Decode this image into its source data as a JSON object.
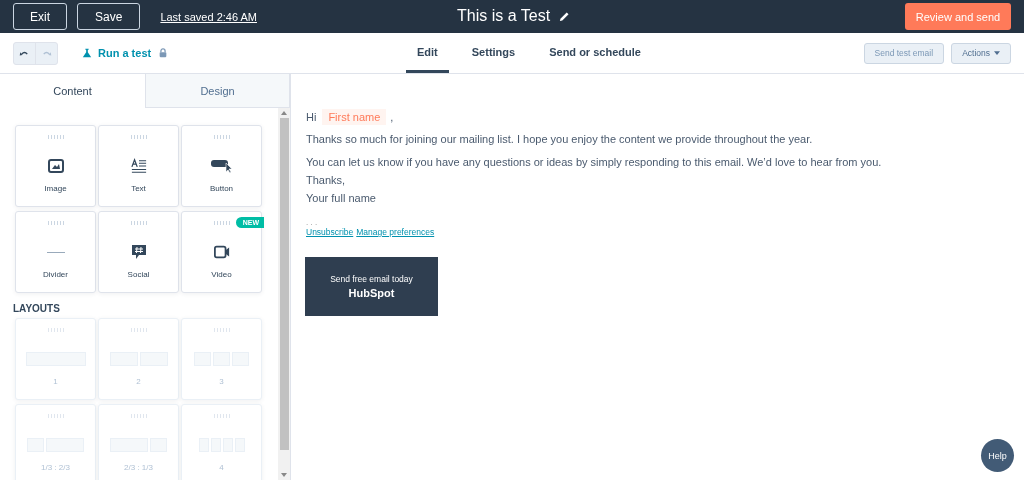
{
  "top_bar": {
    "buttons": [
      "Exit",
      "Save"
    ],
    "last_saved": "Last saved 2:46 AM",
    "title": "This is a Test",
    "primary_button": "Review and send"
  },
  "toolbar": {
    "run_test": "Run a test",
    "tabs": [
      {
        "label": "Edit",
        "selected": true
      },
      {
        "label": "Settings",
        "selected": false
      },
      {
        "label": "Send or schedule",
        "selected": false
      }
    ],
    "send_test": "Send test email",
    "actions": "Actions"
  },
  "sidebar": {
    "tabs": [
      {
        "label": "Content",
        "selected": true
      },
      {
        "label": "Design",
        "selected": false
      }
    ],
    "modules": [
      {
        "label": "Image",
        "kind": "image"
      },
      {
        "label": "Text",
        "kind": "text"
      },
      {
        "label": "Button",
        "kind": "button"
      },
      {
        "label": "Divider",
        "kind": "divider"
      },
      {
        "label": "Social",
        "kind": "social"
      },
      {
        "label": "Video",
        "kind": "video",
        "badge": "NEW"
      }
    ],
    "layouts_heading": "LAYOUTS",
    "layouts": [
      {
        "label": "1",
        "kind": "full"
      },
      {
        "label": "2",
        "kind": "halves"
      },
      {
        "label": "3",
        "kind": "thirds"
      },
      {
        "label": "1/3 : 2/3",
        "kind": "third-twothirds"
      },
      {
        "label": "2/3 : 1/3",
        "kind": "twothirds-third"
      },
      {
        "label": "4",
        "kind": "quarters"
      }
    ]
  },
  "email": {
    "greeting": "Hi",
    "token": "First name",
    "comma": ",",
    "paragraphs": [
      "Thanks so much for joining our mailing list. I hope you enjoy the content we provide throughout the year.",
      "You can let us know if you have any questions or ideas by simply responding to this email. We’d love to hear from you."
    ],
    "signoff": [
      "Thanks,",
      "Your full name"
    ],
    "ellipsis": ". . .",
    "links": [
      "Unsubscribe",
      "Manage preferences"
    ],
    "banner": {
      "text": "Send free email today",
      "logo": "HubSpot"
    }
  },
  "help": "Help"
}
